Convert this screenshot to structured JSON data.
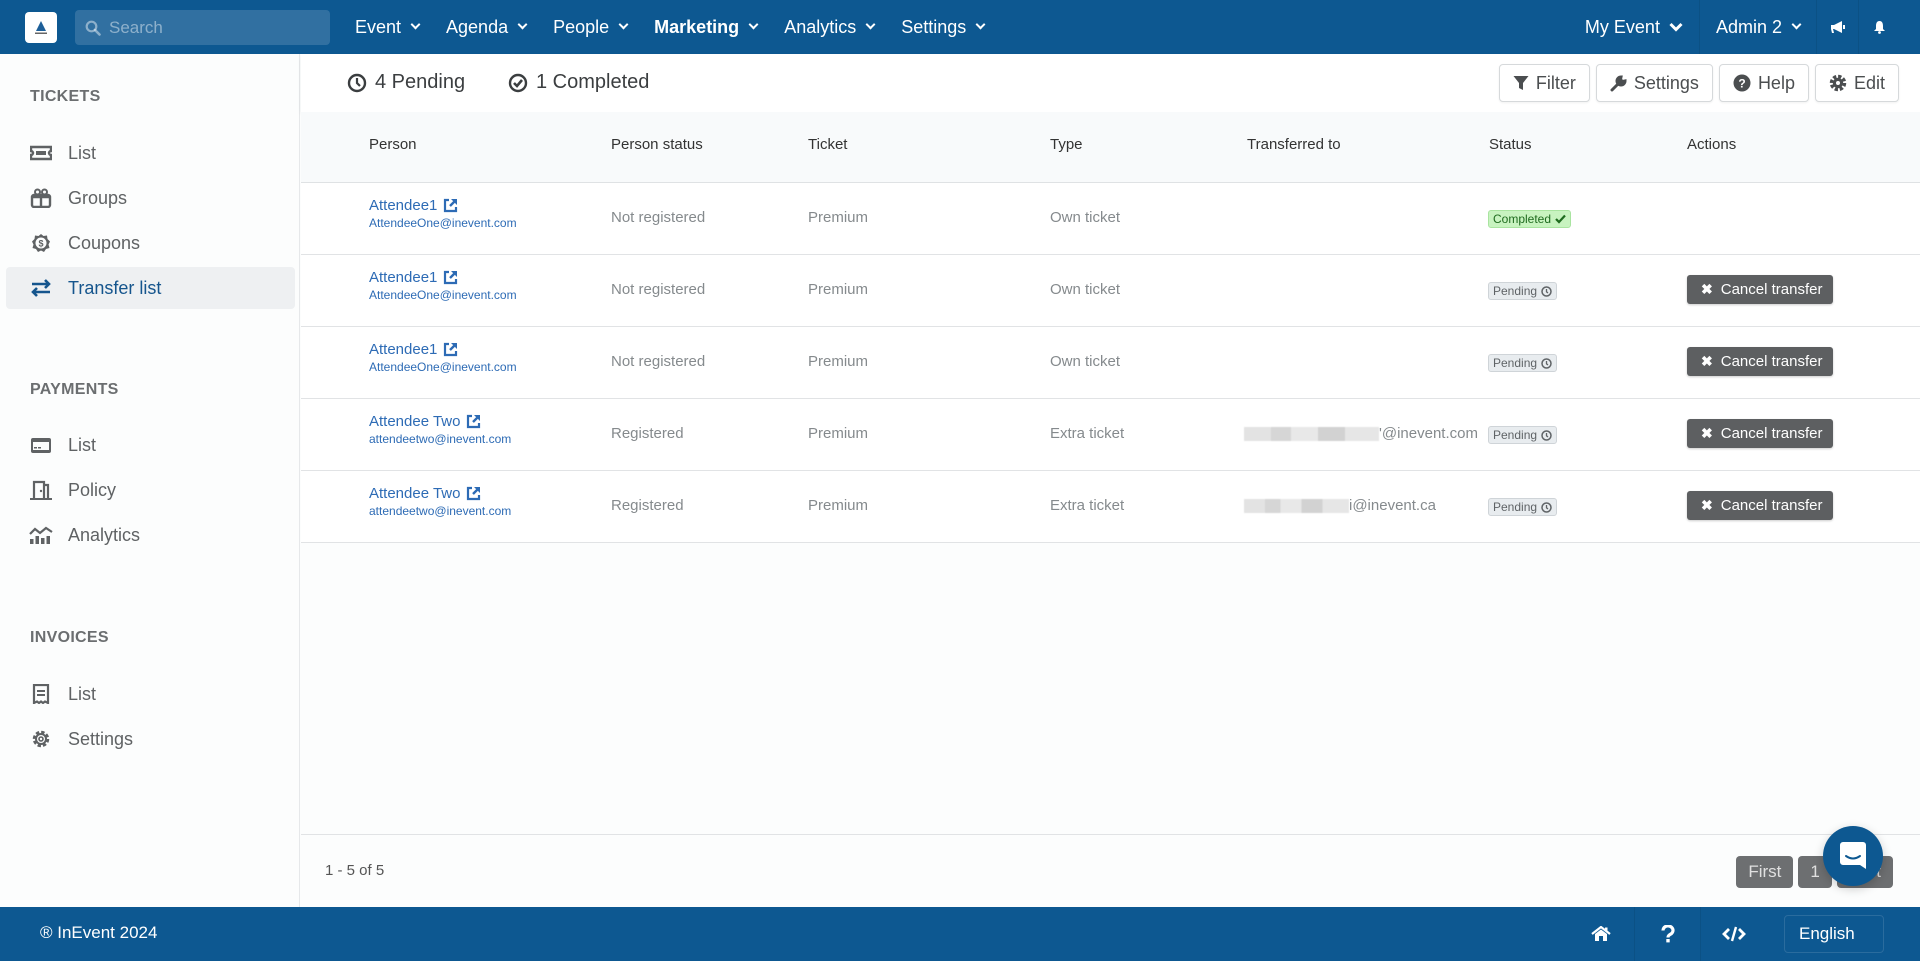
{
  "topbar": {
    "search_placeholder": "Search",
    "nav": [
      {
        "label": "Event",
        "bold": false
      },
      {
        "label": "Agenda",
        "bold": false
      },
      {
        "label": "People",
        "bold": false
      },
      {
        "label": "Marketing",
        "bold": true
      },
      {
        "label": "Analytics",
        "bold": false
      },
      {
        "label": "Settings",
        "bold": false
      }
    ],
    "event_selector": "My Event",
    "user_menu": "Admin 2",
    "icons": [
      "megaphone-icon",
      "bell-icon"
    ]
  },
  "sidebar": {
    "sections": [
      {
        "title": "TICKETS",
        "items": [
          {
            "label": "List",
            "icon": "ticket-icon",
            "active": false
          },
          {
            "label": "Groups",
            "icon": "gift-box-icon",
            "active": false
          },
          {
            "label": "Coupons",
            "icon": "coupon-dollar-icon",
            "active": false
          },
          {
            "label": "Transfer list",
            "icon": "transfer-arrows-icon",
            "active": true
          }
        ]
      },
      {
        "title": "PAYMENTS",
        "items": [
          {
            "label": "List",
            "icon": "credit-card-icon",
            "active": false
          },
          {
            "label": "Policy",
            "icon": "policy-door-icon",
            "active": false
          },
          {
            "label": "Analytics",
            "icon": "chart-analytics-icon",
            "active": false
          }
        ]
      },
      {
        "title": "INVOICES",
        "items": [
          {
            "label": "List",
            "icon": "receipt-icon",
            "active": false
          },
          {
            "label": "Settings",
            "icon": "gear-icon",
            "active": false
          }
        ]
      }
    ]
  },
  "toolbar": {
    "pending_label": "4 Pending",
    "completed_label": "1 Completed",
    "buttons": {
      "filter": "Filter",
      "settings": "Settings",
      "help": "Help",
      "edit": "Edit"
    }
  },
  "table": {
    "columns": [
      "Person",
      "Person status",
      "Ticket",
      "Type",
      "Transferred to",
      "Status",
      "Actions"
    ],
    "rows": [
      {
        "name": "Attendee1",
        "email": "AttendeeOne@inevent.com",
        "person_status": "Not registered",
        "ticket": "Premium",
        "type": "Own ticket",
        "transferred_to": "",
        "status": "Completed",
        "action": ""
      },
      {
        "name": "Attendee1",
        "email": "AttendeeOne@inevent.com",
        "person_status": "Not registered",
        "ticket": "Premium",
        "type": "Own ticket",
        "transferred_to": "",
        "status": "Pending",
        "action": "Cancel transfer"
      },
      {
        "name": "Attendee1",
        "email": "AttendeeOne@inevent.com",
        "person_status": "Not registered",
        "ticket": "Premium",
        "type": "Own ticket",
        "transferred_to": "",
        "status": "Pending",
        "action": "Cancel transfer"
      },
      {
        "name": "Attendee Two",
        "email": "attendeetwo@inevent.com",
        "person_status": "Registered",
        "ticket": "Premium",
        "type": "Extra ticket",
        "transferred_to": "'@inevent.com",
        "transferred_redacted": true,
        "status": "Pending",
        "action": "Cancel transfer"
      },
      {
        "name": "Attendee Two",
        "email": "attendeetwo@inevent.com",
        "person_status": "Registered",
        "ticket": "Premium",
        "type": "Extra ticket",
        "transferred_to": "i@inevent.ca",
        "transferred_redacted": true,
        "status": "Pending",
        "action": "Cancel transfer"
      }
    ],
    "count_label": "1 - 5 of 5",
    "pagination": [
      "First",
      "1",
      "Last"
    ]
  },
  "footer": {
    "copyright": "® InEvent 2024",
    "language": "English",
    "icons": [
      "home-icon",
      "question-icon",
      "code-icon"
    ]
  },
  "colors": {
    "brand": "#0d5891",
    "link": "#2d6bb5",
    "completed_bg": "#c8f3c0",
    "pending_bg": "#e8ecef",
    "cancel_btn": "#5d5f61"
  }
}
